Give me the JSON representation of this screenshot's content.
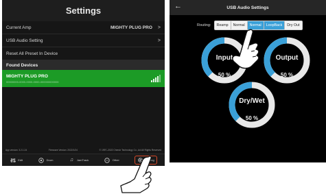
{
  "left": {
    "title": "Settings",
    "rows": [
      {
        "label": "Current Amp",
        "value": "MIGHTY PLUG PRO",
        "chevron": ">"
      },
      {
        "label": "USB Audio Setting",
        "value": "",
        "chevron": ">"
      },
      {
        "label": "Reset All Preset In Device",
        "value": "",
        "chevron": ""
      }
    ],
    "section": "Found Devices",
    "device": {
      "name": "MIGHTY PLUG PRO",
      "sub": "00000000-0000-0000-0000-000000000000",
      "signal_bars": 4
    },
    "footer": {
      "app_version": "App version: 3.2.1.24",
      "firmware_version": "Firmware Version: 2022/1/24",
      "copyright": "© 1997–2022 Cherub Technology Co.,Ltd All Rights Reserved"
    },
    "tabs": [
      {
        "label": "Edit",
        "icon": "sliders-icon"
      },
      {
        "label": "Drum",
        "icon": "drum-icon"
      },
      {
        "label": "JamTrack",
        "icon": "music-note-icon"
      },
      {
        "label": "Other",
        "icon": "dots-icon"
      },
      {
        "label": "Setting",
        "icon": "gear-icon",
        "active": true
      }
    ]
  },
  "right": {
    "title": "USB Audio Settings",
    "back_icon": "back-arrow-icon",
    "routing_label": "Routing:",
    "routing_options": [
      "Reamp",
      "Normal",
      "Normal",
      "LoopBack",
      "Dry Out"
    ],
    "routing_selected": [
      2,
      3
    ],
    "knobs": [
      {
        "name": "Input",
        "value": "50 %",
        "level": 0.5
      },
      {
        "name": "Output",
        "value": "50 %",
        "level": 0.5
      },
      {
        "name": "Dry/Wet",
        "value": "50 %",
        "level": 0.5
      }
    ]
  },
  "colors": {
    "accent": "#3aa0d8",
    "device_green": "#1c9b26",
    "active_tab": "#d84a2a",
    "background": "#161616"
  }
}
